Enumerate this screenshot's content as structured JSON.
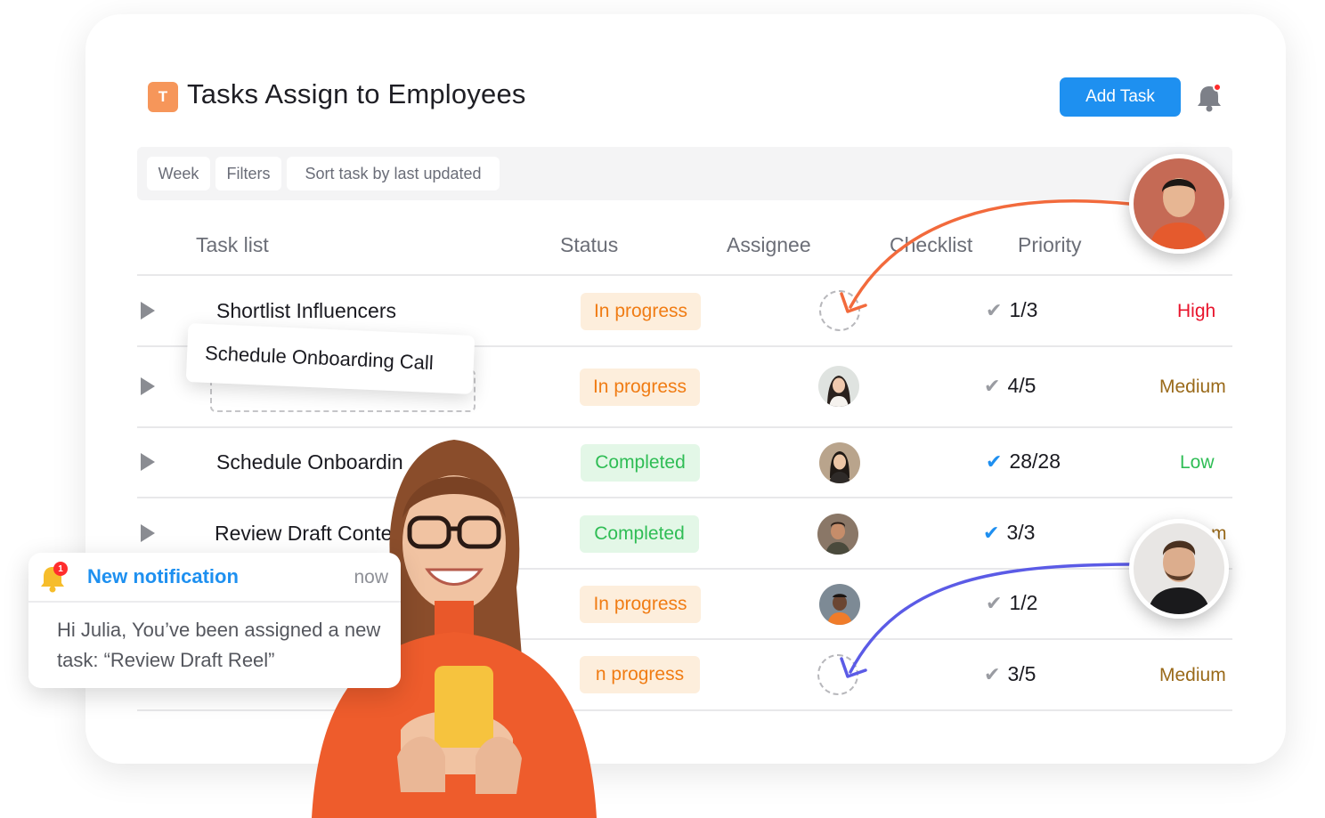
{
  "header": {
    "logo_letter": "T",
    "title": "Tasks Assign to Employees",
    "add_task_label": "Add Task"
  },
  "toolbar": {
    "week_label": "Week",
    "filters_label": "Filters",
    "sort_label": "Sort task by last updated"
  },
  "columns": {
    "task_list": "Task list",
    "status": "Status",
    "assignee": "Assignee",
    "checklist": "Checklist",
    "priority": "Priority"
  },
  "rows": [
    {
      "task": "Shortlist Influencers",
      "status": "In progress",
      "checklist": "1/3",
      "checklist_done": false,
      "priority": "High",
      "priority_color": "#e8142c",
      "assignee": "empty"
    },
    {
      "task": "",
      "status": "In progress",
      "checklist": "4/5",
      "checklist_done": false,
      "priority": "Medium",
      "priority_color": "#9a6a1a",
      "assignee": "woman-1"
    },
    {
      "task": "Schedule Onboardin",
      "status": "Completed",
      "checklist": "28/28",
      "checklist_done": true,
      "priority": "Low",
      "priority_color": "#2fbd55",
      "assignee": "woman-2"
    },
    {
      "task": "Review Draft Conte",
      "status": "Completed",
      "checklist": "3/3",
      "checklist_done": true,
      "priority": "m",
      "priority_color": "#9a6a1a",
      "assignee": "man-1"
    },
    {
      "task": "",
      "status": "In progress",
      "checklist": "1/2",
      "checklist_done": false,
      "priority": "",
      "priority_color": "#2fbd55",
      "assignee": "man-2"
    },
    {
      "task": "",
      "status": "n progress",
      "checklist": "3/5",
      "checklist_done": false,
      "priority": "Medium",
      "priority_color": "#9a6a1a",
      "assignee": "empty"
    }
  ],
  "drag_card": {
    "label": "Schedule Onboarding Call"
  },
  "notification": {
    "badge": "1",
    "title": "New notification",
    "time": "now",
    "body": "Hi Julia, You’ve been assigned a new task: “Review Draft Reel”"
  },
  "colors": {
    "accent": "#1e90f0",
    "logo": "#f6965a",
    "in_progress_bg": "#fdeedc",
    "in_progress_text": "#f07c14",
    "completed_bg": "#e3f7e7",
    "completed_text": "#2fbd55",
    "orange_arrow": "#f26a3c",
    "purple_arrow": "#5b5be6"
  }
}
